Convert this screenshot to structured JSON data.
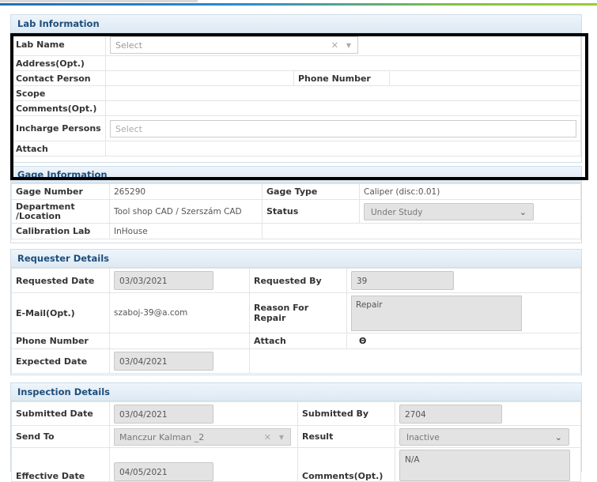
{
  "lab_info": {
    "header": "Lab Information",
    "lab_name_label": "Lab Name",
    "lab_name_placeholder": "Select",
    "address_label": "Address(Opt.)",
    "contact_label": "Contact Person",
    "phone_label": "Phone Number",
    "scope_label": "Scope",
    "comments_label": "Comments(Opt.)",
    "incharge_label": "Incharge Persons",
    "incharge_placeholder": "Select",
    "attach_label": "Attach"
  },
  "gage_info": {
    "header": "Gage Information",
    "gage_number_label": "Gage Number",
    "gage_number": "265290",
    "gage_type_label": "Gage Type",
    "gage_type": "Caliper (disc:0.01)",
    "department_label_1": "Department",
    "department_label_2": "/Location",
    "department": "Tool shop CAD / Szerszám CAD",
    "status_label": "Status",
    "status": "Under Study",
    "calibration_lab_label": "Calibration Lab",
    "calibration_lab": "InHouse"
  },
  "requester": {
    "header": "Requester Details",
    "requested_date_label": "Requested Date",
    "requested_date": "03/03/2021",
    "requested_by_label": "Requested By",
    "requested_by": "39",
    "email_label": "E-Mail(Opt.)",
    "email": "szaboj-39@a.com",
    "reason_label": "Reason For Repair",
    "reason": "Repair",
    "phone_label": "Phone Number",
    "attach_label": "Attach",
    "attach_icon": "Θ",
    "expected_date_label": "Expected Date",
    "expected_date": "03/04/2021"
  },
  "inspection": {
    "header": "Inspection Details",
    "submitted_date_label": "Submitted Date",
    "submitted_date": "03/04/2021",
    "submitted_by_label": "Submitted By",
    "submitted_by": "2704",
    "send_to_label": "Send To",
    "send_to": "Manczur Kalman _2",
    "result_label": "Result",
    "result": "Inactive",
    "effective_date_label": "Effective Date",
    "effective_date": "04/05/2021",
    "comments_label": "Comments(Opt.)",
    "comments": "N/A"
  }
}
